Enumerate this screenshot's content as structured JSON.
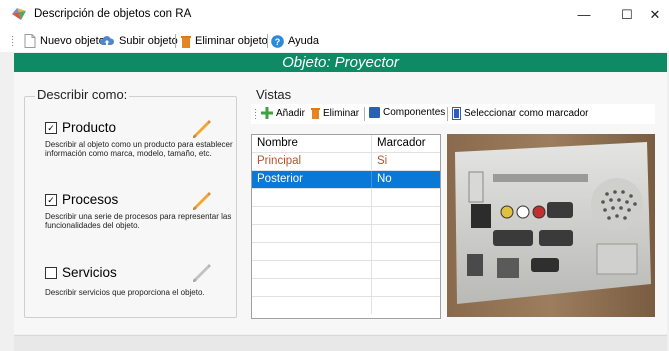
{
  "window": {
    "title": "Descripción de objetos con RA",
    "minimize": "—",
    "maximize": "☐",
    "close": "✕"
  },
  "toolbar": {
    "new_object": "Nuevo objeto",
    "upload_object": "Subir objeto",
    "delete_object": "Eliminar objeto",
    "help": "Ayuda"
  },
  "header": {
    "title": "Objeto: Proyector"
  },
  "describe": {
    "title": "Describir como:",
    "options": [
      {
        "label": "Producto",
        "checked": true,
        "check_glyph": "✓",
        "description": "Describir al objeto como un producto para establecer información como marca, modelo, tamaño, etc."
      },
      {
        "label": "Procesos",
        "checked": true,
        "check_glyph": "✓",
        "description": "Describir una serie de procesos para representar las funcionalidades del objeto."
      },
      {
        "label": "Servicios",
        "checked": false,
        "check_glyph": "",
        "description": "Describir servicios que proporciona el objeto."
      }
    ]
  },
  "vistas": {
    "title": "Vistas",
    "toolbar": {
      "add": "Añadir",
      "delete": "Eliminar",
      "components": "Componentes",
      "set_marker": "Seleccionar como marcador"
    },
    "columns": {
      "name": "Nombre",
      "marker": "Marcador"
    },
    "rows": [
      {
        "name": "Principal",
        "marker": "Si",
        "selected": false
      },
      {
        "name": "Posterior",
        "marker": "No",
        "selected": true
      }
    ]
  },
  "colors": {
    "accent": "#0e8a64",
    "selection": "#0a78d7",
    "row_text": "#b4532a",
    "pencil_active": "#f0a830",
    "pencil_disabled": "#b5b5b5"
  }
}
